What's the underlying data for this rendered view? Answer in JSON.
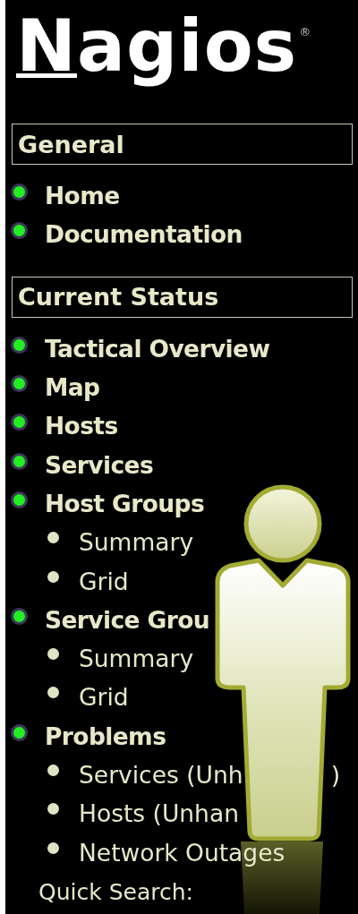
{
  "logo": {
    "text": "Nagios",
    "mark": "®"
  },
  "sections": [
    {
      "title": "General",
      "items": [
        {
          "label": "Home"
        },
        {
          "label": "Documentation"
        }
      ]
    },
    {
      "title": "Current Status",
      "items": [
        {
          "label": "Tactical Overview"
        },
        {
          "label": "Map"
        },
        {
          "label": "Hosts"
        },
        {
          "label": "Services"
        },
        {
          "label": "Host Groups",
          "children": [
            {
              "label": "Summary"
            },
            {
              "label": "Grid"
            }
          ]
        },
        {
          "label": "Service Grou",
          "children": [
            {
              "label": "Summary"
            },
            {
              "label": "Grid"
            }
          ]
        },
        {
          "label": "Problems",
          "children": [
            {
              "label": "Services (Unh",
              "tail": ")"
            },
            {
              "label": "Hosts (Unhan"
            },
            {
              "label": "Network Outages"
            }
          ]
        }
      ]
    }
  ],
  "quick_search": {
    "label": "Quick Search:"
  }
}
